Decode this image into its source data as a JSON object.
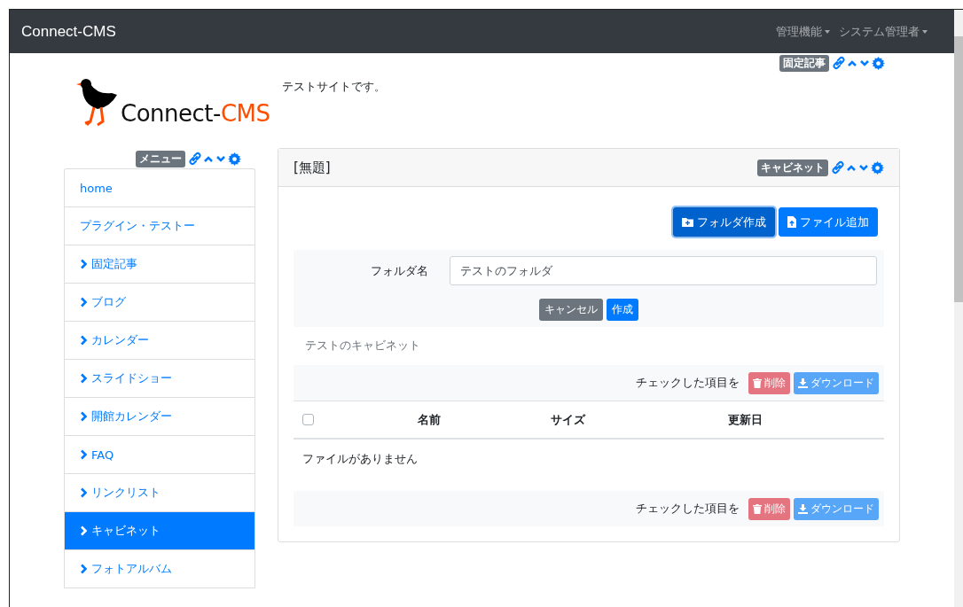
{
  "navbar": {
    "brand": "Connect-CMS",
    "menus": [
      {
        "label": "管理機能"
      },
      {
        "label": "システム管理者"
      }
    ]
  },
  "header": {
    "frame_badge": "固定記事",
    "logo_parts": [
      "Connect-",
      "CMS"
    ],
    "site_text": "テストサイトです。"
  },
  "sidebar": {
    "frame_badge": "メニュー",
    "items": [
      {
        "label": "home",
        "kind": "plain",
        "selected": false
      },
      {
        "label": "プラグイン・テストー",
        "kind": "plain",
        "selected": false
      },
      {
        "label": "固定記事",
        "kind": "chevron",
        "selected": false
      },
      {
        "label": "ブログ",
        "kind": "chevron",
        "selected": false
      },
      {
        "label": "カレンダー",
        "kind": "chevron",
        "selected": false
      },
      {
        "label": "スライドショー",
        "kind": "chevron",
        "selected": false
      },
      {
        "label": "開館カレンダー",
        "kind": "chevron",
        "selected": false
      },
      {
        "label": "FAQ",
        "kind": "chevron",
        "selected": false
      },
      {
        "label": "リンクリスト",
        "kind": "chevron",
        "selected": false
      },
      {
        "label": "キャビネット",
        "kind": "chevron",
        "selected": true
      },
      {
        "label": "フォトアルバム",
        "kind": "chevron",
        "selected": false
      }
    ]
  },
  "panel": {
    "title": "[無題]",
    "frame_badge": "キャビネット",
    "buttons": [
      {
        "label": "フォルダ作成",
        "kind": "folder",
        "active": true
      },
      {
        "label": "ファイル追加",
        "kind": "file",
        "active": false
      }
    ],
    "folder_form": {
      "label": "フォルダ名",
      "value": "テストのフォルダ",
      "cancel": "キャンセル",
      "submit": "作成"
    },
    "cabinet_name": "テストのキャビネット",
    "top_actions": {
      "text": "チェックした項目を",
      "delete": "削除",
      "download": "ダウンロード",
      "disabled": true
    },
    "table": {
      "select_all_checked": false,
      "columns": [
        "名前",
        "サイズ",
        "更新日"
      ],
      "empty_text": "ファイルがありません"
    },
    "bottom_actions": {
      "text": "チェックした項目を",
      "delete": "削除",
      "download": "ダウンロード",
      "disabled": true
    }
  }
}
